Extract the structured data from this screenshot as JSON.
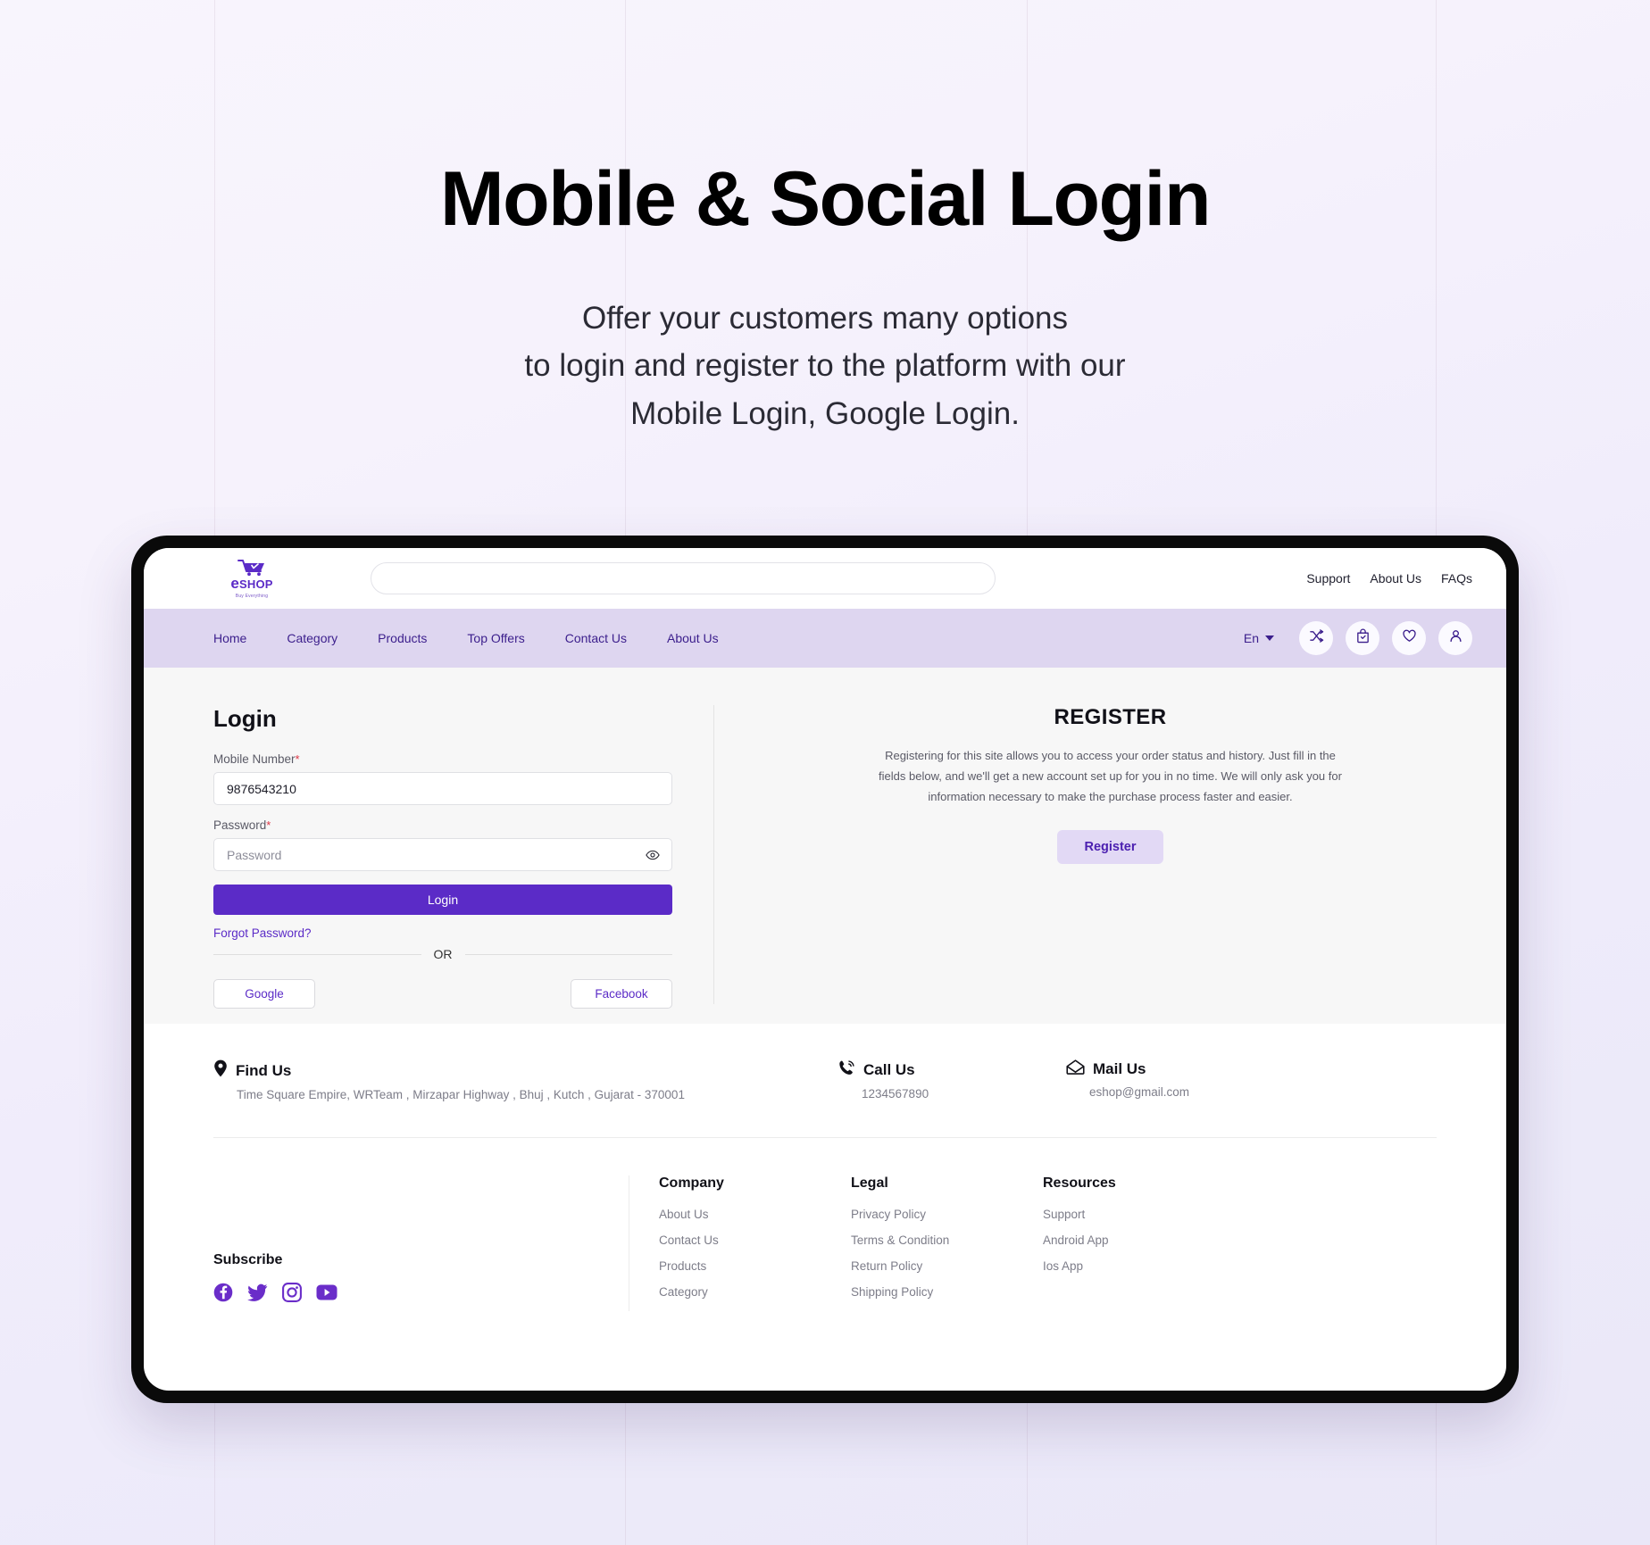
{
  "hero": {
    "title": "Mobile & Social Login",
    "subtitle_line1": "Offer your customers many options",
    "subtitle_line2": "to login and register to the platform with our",
    "subtitle_line3": "Mobile Login, Google Login."
  },
  "colors": {
    "primary_purple": "#5b2bc7",
    "nav_lavender": "#ded6f0",
    "register_btn_bg": "#e2d9f5",
    "content_bg": "#f7f7f7",
    "required_red": "#dc3545"
  },
  "topbar": {
    "logo_text_e": "e",
    "logo_text_shop": "SHOP",
    "logo_tagline": "Buy Everything",
    "search_placeholder": "",
    "search_value": "",
    "links": [
      {
        "label": "Support"
      },
      {
        "label": "About Us"
      },
      {
        "label": "FAQs"
      }
    ]
  },
  "navbar": {
    "items": [
      {
        "label": "Home"
      },
      {
        "label": "Category"
      },
      {
        "label": "Products"
      },
      {
        "label": "Top Offers"
      },
      {
        "label": "Contact Us"
      },
      {
        "label": "About Us"
      }
    ],
    "language": "En",
    "icons": [
      {
        "name": "compare-icon"
      },
      {
        "name": "shopping-bag-icon"
      },
      {
        "name": "heart-icon"
      },
      {
        "name": "user-icon"
      }
    ]
  },
  "login": {
    "title": "Login",
    "mobile_label": "Mobile Number",
    "mobile_required": "*",
    "mobile_value": "9876543210",
    "password_label": "Password",
    "password_required": "*",
    "password_placeholder": "Password",
    "login_button": "Login",
    "forgot_password": "Forgot Password?",
    "or_text": "OR",
    "google_button": "Google",
    "facebook_button": "Facebook"
  },
  "register": {
    "title": "REGISTER",
    "description": "Registering for this site allows you to access your order status and history. Just fill in the fields below, and we'll get a new account set up for you in no time. We will only ask you for information necessary to make the purchase process faster and easier.",
    "button": "Register"
  },
  "footer": {
    "find_us": {
      "title": "Find Us",
      "value": "Time Square Empire, WRTeam , Mirzapar Highway , Bhuj , Kutch , Gujarat - 370001"
    },
    "call_us": {
      "title": "Call Us",
      "value": "1234567890"
    },
    "mail_us": {
      "title": "Mail Us",
      "value": "eshop@gmail.com"
    },
    "subscribe_title": "Subscribe",
    "socials": [
      {
        "name": "facebook-icon"
      },
      {
        "name": "twitter-icon"
      },
      {
        "name": "instagram-icon"
      },
      {
        "name": "youtube-icon"
      }
    ],
    "columns": [
      {
        "title": "Company",
        "items": [
          {
            "label": "About Us"
          },
          {
            "label": "Contact Us"
          },
          {
            "label": "Products"
          },
          {
            "label": "Category"
          }
        ]
      },
      {
        "title": "Legal",
        "items": [
          {
            "label": "Privacy Policy"
          },
          {
            "label": "Terms & Condition"
          },
          {
            "label": "Return Policy"
          },
          {
            "label": "Shipping Policy"
          }
        ]
      },
      {
        "title": "Resources",
        "items": [
          {
            "label": "Support"
          },
          {
            "label": "Android App"
          },
          {
            "label": "Ios App"
          }
        ]
      }
    ]
  }
}
